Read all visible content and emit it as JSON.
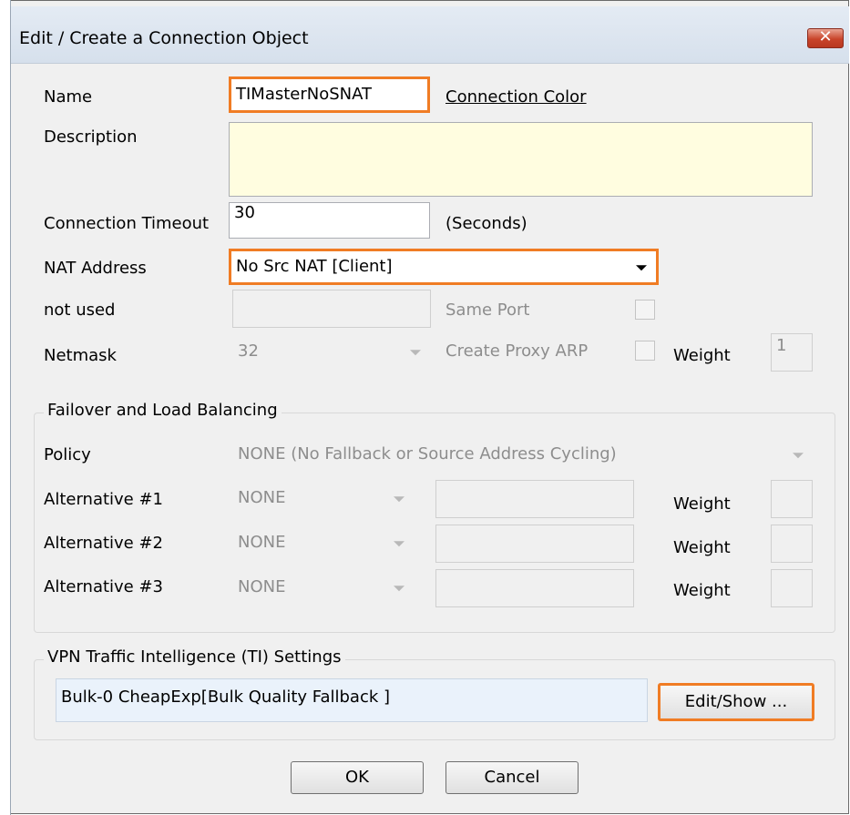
{
  "dialog": {
    "title": "Edit / Create a Connection Object",
    "close_glyph": "✕"
  },
  "fields": {
    "name_label": "Name",
    "name_value": "TIMasterNoSNAT",
    "connection_color_link": "Connection Color",
    "description_label": "Description",
    "description_value": "",
    "timeout_label": "Connection Timeout",
    "timeout_value": "30",
    "timeout_unit": "(Seconds)",
    "nat_label": "NAT Address",
    "nat_value": "No Src NAT [Client]",
    "not_used_label": "not used",
    "not_used_value": "",
    "same_port_label": "Same Port",
    "netmask_label": "Netmask",
    "netmask_value": "32",
    "proxy_arp_label": "Create Proxy ARP",
    "weight_label": "Weight",
    "weight_value": "1"
  },
  "failover": {
    "group_label": "Failover and Load Balancing",
    "policy_label": "Policy",
    "policy_value": "NONE (No Fallback or Source Address Cycling)",
    "alternatives": [
      {
        "label": "Alternative #1",
        "value": "NONE",
        "weight_label": "Weight"
      },
      {
        "label": "Alternative #2",
        "value": "NONE",
        "weight_label": "Weight"
      },
      {
        "label": "Alternative #3",
        "value": "NONE",
        "weight_label": "Weight"
      }
    ]
  },
  "vpn": {
    "group_label": "VPN Traffic Intelligence (TI) Settings",
    "value": "Bulk-0 CheapExp[Bulk Quality Fallback ]",
    "edit_button": "Edit/Show ..."
  },
  "buttons": {
    "ok": "OK",
    "cancel": "Cancel"
  },
  "colors": {
    "highlight": "#f07c24",
    "description_bg": "#fffde0",
    "vpn_field_bg": "#eaf2fb"
  }
}
